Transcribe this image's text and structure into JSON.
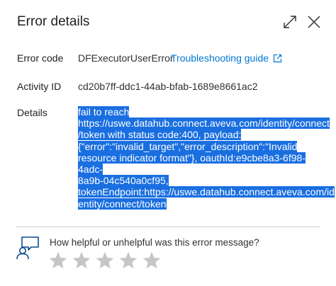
{
  "panel": {
    "title": "Error details"
  },
  "header": {
    "expand_icon": "expand-diagonal-icon",
    "close_icon": "close-icon"
  },
  "fields": {
    "error_code_label": "Error code",
    "error_code_value": "DFExecutorUserError",
    "troubleshooting_link": "Troubleshooting guide",
    "activity_id_label": "Activity ID",
    "activity_id_value": "cd20b7ff-ddc1-44ab-bfab-1689e8661ac2",
    "details_label": "Details",
    "details_lines": [
      "fail to reach",
      "https://uswe.datahub.connect.aveva.com/identity/connect",
      "/token with status code:400, payload:",
      "{\"error\":\"invalid_target\",\"error_description\":\"Invalid",
      "resource indicator format\"}, oauthId:e9cbe8a3-6f98-4adc-",
      "8a9b-04c540a0cf95,",
      "tokenEndpoint:https://uswe.datahub.connect.aveva.com/id",
      "entity/connect/token"
    ]
  },
  "feedback": {
    "icon": "feedback-person-chat-icon",
    "question": "How helpful or unhelpful was this error message?",
    "star_count": 5,
    "rating": 0
  },
  "colors": {
    "link": "#0078d4",
    "selection": "#1a6fe0",
    "star": "#c8c6c4"
  }
}
